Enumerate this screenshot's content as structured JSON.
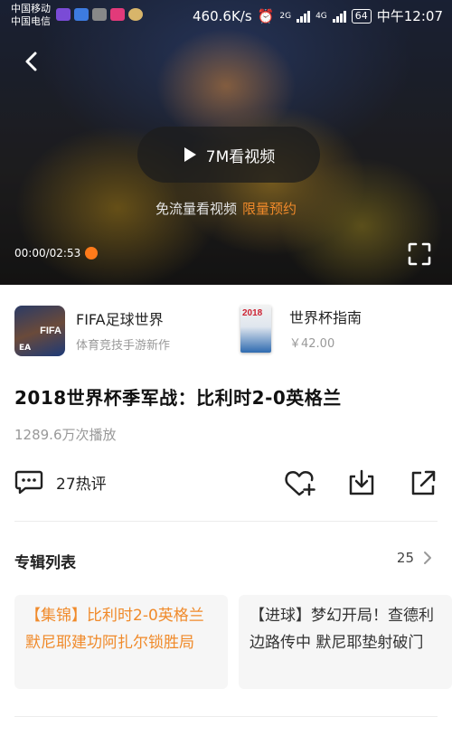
{
  "status_bar": {
    "carrier_1": "中国移动",
    "carrier_2": "中国电信",
    "net_speed": "460.6K/s",
    "network_1": "2G",
    "network_2": "4G",
    "battery": "64",
    "time": "中午12:07"
  },
  "video": {
    "play_label": "7M看视频",
    "free_text": "免流量看视频",
    "free_link": "限量预约",
    "time": "00:00/02:53",
    "progress_fraction": 0.0
  },
  "products": [
    {
      "title": "FIFA足球世界",
      "subtitle": "体育竞技手游新作",
      "image_text": "FIFA",
      "image_brand": "EA"
    },
    {
      "title": "世界杯指南",
      "subtitle": "￥42.00",
      "image_text": "2018"
    }
  ],
  "info": {
    "title": "2018世界杯季军战：比利时2-0英格兰",
    "play_count": "1289.6万次播放",
    "comments": "27热评"
  },
  "album": {
    "title": "专辑列表",
    "count": "25",
    "items": [
      {
        "text": "【集锦】比利时2-0英格兰 默尼耶建功阿扎尔锁胜局",
        "active": true
      },
      {
        "text": "【进球】梦幻开局！查德利边路传中 默尼耶垫射破门",
        "active": false
      }
    ]
  },
  "colors": {
    "accent": "#f08a2a",
    "progress": "#ff7a1a"
  }
}
